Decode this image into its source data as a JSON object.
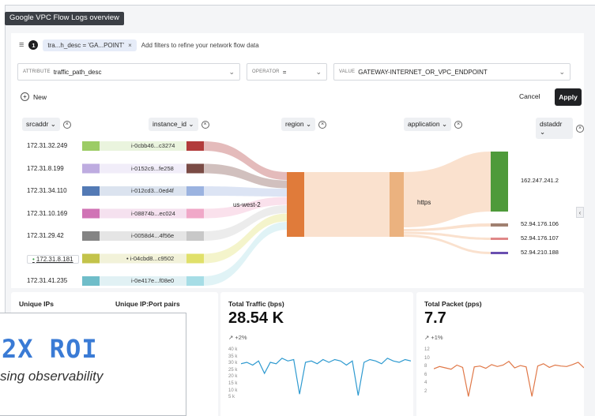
{
  "window": {
    "title": "Google VPC Flow Logs overview"
  },
  "filterbar": {
    "count": "1",
    "chip": "tra...h_desc = 'GA...POINT'",
    "add_filters": "Add filters to refine your network flow data"
  },
  "editor": {
    "attribute_prefix": "ATTRIBUTE",
    "attribute_value": "traffic_path_desc",
    "operator_prefix": "OPERATOR",
    "operator_value": "=",
    "value_prefix": "VALUE",
    "value_value": "GATEWAY-INTERNET_OR_VPC_ENDPOINT",
    "new_label": "New",
    "cancel_label": "Cancel",
    "apply_label": "Apply"
  },
  "sankey": {
    "columns": [
      "srcaddr",
      "instance_id",
      "region",
      "application",
      "dstaddr"
    ],
    "sources": [
      {
        "ip": "172.31.32.249",
        "instance": "i-0cbb46...c3274",
        "color": "#8bc34a",
        "inst_color": "#b23b3b"
      },
      {
        "ip": "172.31.8.199",
        "instance": "i-0152c9...fe258",
        "color": "#b39ddb",
        "inst_color": "#7a4b45"
      },
      {
        "ip": "172.31.34.110",
        "instance": "i-012cd3...0ed4f",
        "color": "#3563a8",
        "inst_color": "#9bb3e0"
      },
      {
        "ip": "172.31.10.169",
        "instance": "i-08874b...ec024",
        "color": "#c85aa8",
        "inst_color": "#f0a8c8"
      },
      {
        "ip": "172.31.29.42",
        "instance": "i-0058d4...4f56e",
        "color": "#6e6e6e",
        "inst_color": "#c8c8c8"
      },
      {
        "ip": "172.31.8.181",
        "instance": "i-04cbd8...c9502",
        "color": "#b9b92a",
        "inst_color": "#e0e06a",
        "selected": true
      },
      {
        "ip": "172.31.41.235",
        "instance": "i-0e417e...f08e0",
        "color": "#56b1c0",
        "inst_color": "#a6dde6"
      }
    ],
    "region": "us-west-2",
    "application": "https",
    "destinations": [
      {
        "ip": "162.247.241.2",
        "color": "#4e9a3a"
      },
      {
        "ip": "52.94.176.106",
        "color": "#a08070"
      },
      {
        "ip": "52.94.176.107",
        "color": "#e08888"
      },
      {
        "ip": "52.94.210.188",
        "color": "#6a4fb0"
      }
    ]
  },
  "cards": {
    "unique_ips": "Unique IPs",
    "unique_pairs": "Unique IP:Port pairs",
    "traffic": {
      "title": "Total Traffic (bps)",
      "value": "28.54 K",
      "delta": "+2%",
      "yticks": [
        "40 k",
        "35 k",
        "30 k",
        "25 k",
        "20 k",
        "15 k",
        "10 k",
        "5 k"
      ],
      "color": "#2e9ad0"
    },
    "packet": {
      "title": "Total Packet (pps)",
      "value": "7.7",
      "delta": "+1%",
      "yticks": [
        "12",
        "10",
        "8",
        "6",
        "4",
        "2"
      ],
      "color": "#e07848"
    }
  },
  "overlay": {
    "headline": "2X ROI",
    "subline": "sing observability"
  }
}
